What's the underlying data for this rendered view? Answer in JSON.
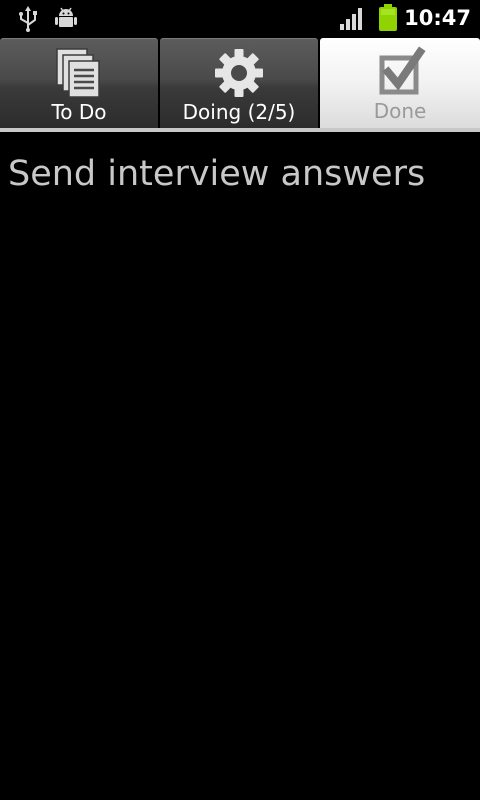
{
  "status_bar": {
    "time": "10:47",
    "icons": [
      "usb-icon",
      "android-debug-icon",
      "signal-icon",
      "battery-icon"
    ],
    "battery_color": "#8fd400"
  },
  "tabs": [
    {
      "label": "To Do",
      "icon": "list-icon",
      "selected": false
    },
    {
      "label": "Doing (2/5)",
      "icon": "gear-icon",
      "selected": false
    },
    {
      "label": "Done",
      "icon": "checkbox-icon",
      "selected": true
    }
  ],
  "tasks": [
    {
      "title": "Send interview answers"
    }
  ],
  "colors": {
    "background": "#000000",
    "task_text": "#c8c8c8",
    "active_tab": "#f2f2f2",
    "inactive_tab": "#4a4a4a"
  }
}
